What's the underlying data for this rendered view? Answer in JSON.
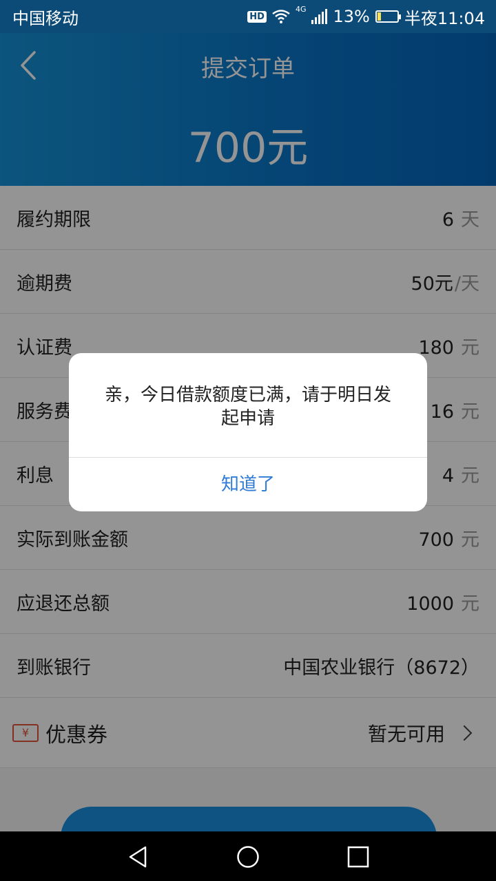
{
  "status_bar": {
    "carrier": "中国移动",
    "hd_badge": "HD",
    "network_label": "4G",
    "battery_percent": "13%",
    "time": "半夜11:04"
  },
  "header": {
    "title": "提交订单",
    "amount": "700元"
  },
  "rows": [
    {
      "label": "履约期限",
      "value": "6",
      "unit": "天"
    },
    {
      "label": "逾期费",
      "value": "50元",
      "unit": "/天"
    },
    {
      "label": "认证费",
      "value": "180",
      "unit": "元"
    },
    {
      "label": "服务费",
      "value": "16",
      "unit": "元"
    },
    {
      "label": "利息",
      "value": "4",
      "unit": "元"
    },
    {
      "label": "实际到账金额",
      "value": "700",
      "unit": "元"
    },
    {
      "label": "应退还总额",
      "value": "1000",
      "unit": "元"
    },
    {
      "label": "到账银行",
      "value": "中国农业银行（8672）",
      "unit": ""
    }
  ],
  "coupon": {
    "icon_text": "¥",
    "label": "优惠券",
    "value": "暂无可用"
  },
  "dialog": {
    "message": "亲，今日借款额度已满，请于明日发起申请",
    "button": "知道了"
  },
  "colors": {
    "header_blue": "#0a77c9",
    "dialog_button_blue": "#2f7bd6",
    "coupon_red": "#e0533a"
  }
}
